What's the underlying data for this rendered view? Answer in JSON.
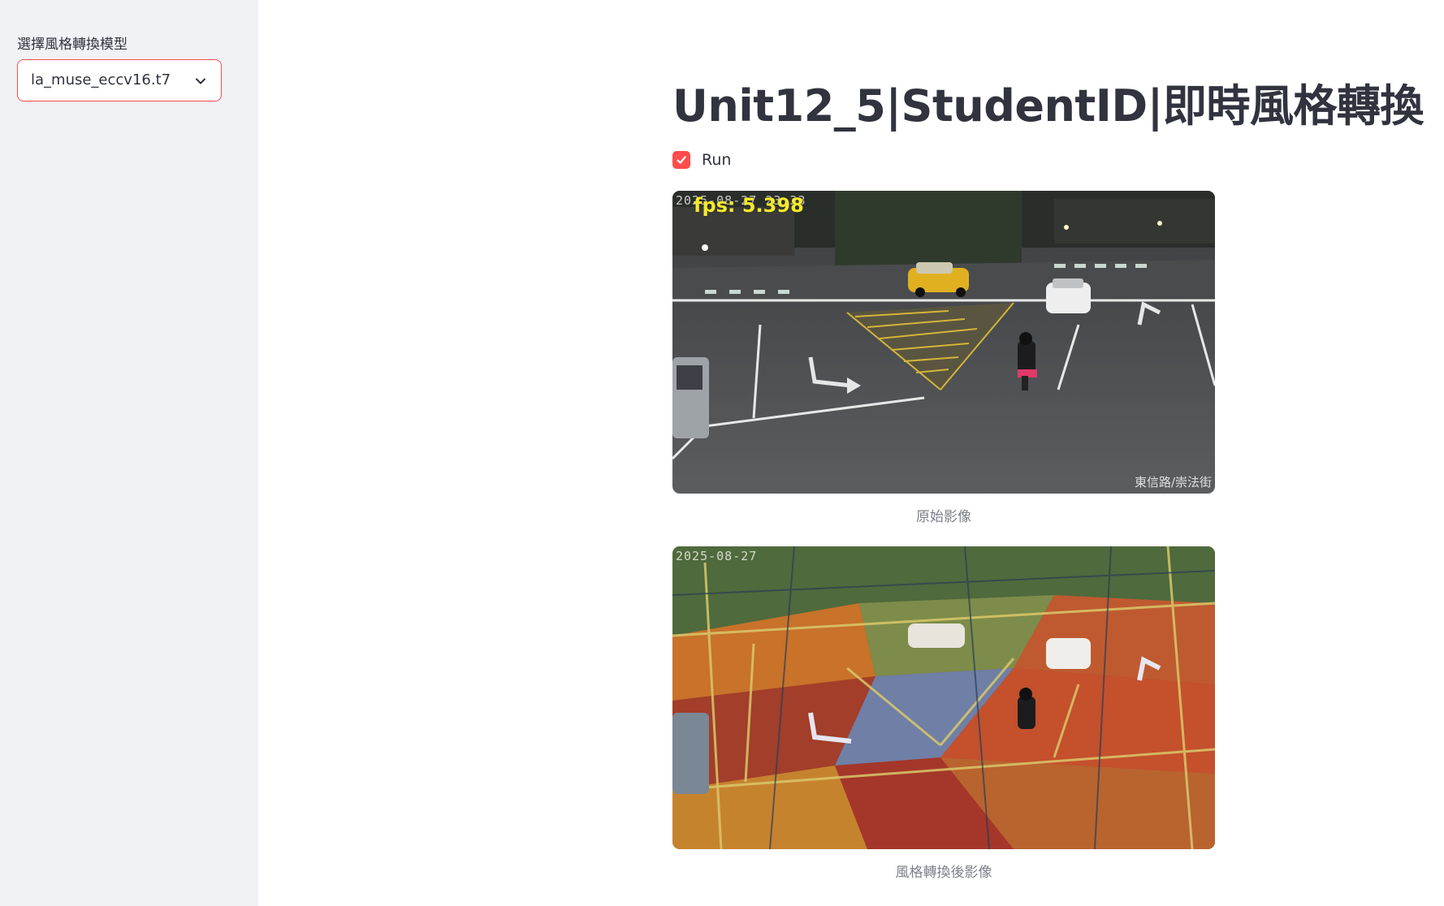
{
  "sidebar": {
    "select_label": "選擇風格轉換模型",
    "select_value": "la_muse_eccv16.t7"
  },
  "main": {
    "title": "Unit12_5|StudentID|即時風格轉換",
    "run_checkbox": {
      "label": "Run",
      "checked": true
    },
    "original_image": {
      "caption": "原始影像",
      "fps_overlay": "fps: 5.398",
      "timestamp_overlay": "2025-08-27 23:33",
      "location_overlay": "東信路/崇法街"
    },
    "styled_image": {
      "caption": "風格轉換後影像",
      "timestamp_overlay": "2025-08-27"
    }
  },
  "colors": {
    "accent": "#ff4b4b",
    "sidebar_bg": "#f0f2f6",
    "text": "#31333f",
    "caption": "#7d808a"
  },
  "icons": {
    "select_chevron": "chevron-down-icon",
    "checkbox_check": "check-icon"
  }
}
